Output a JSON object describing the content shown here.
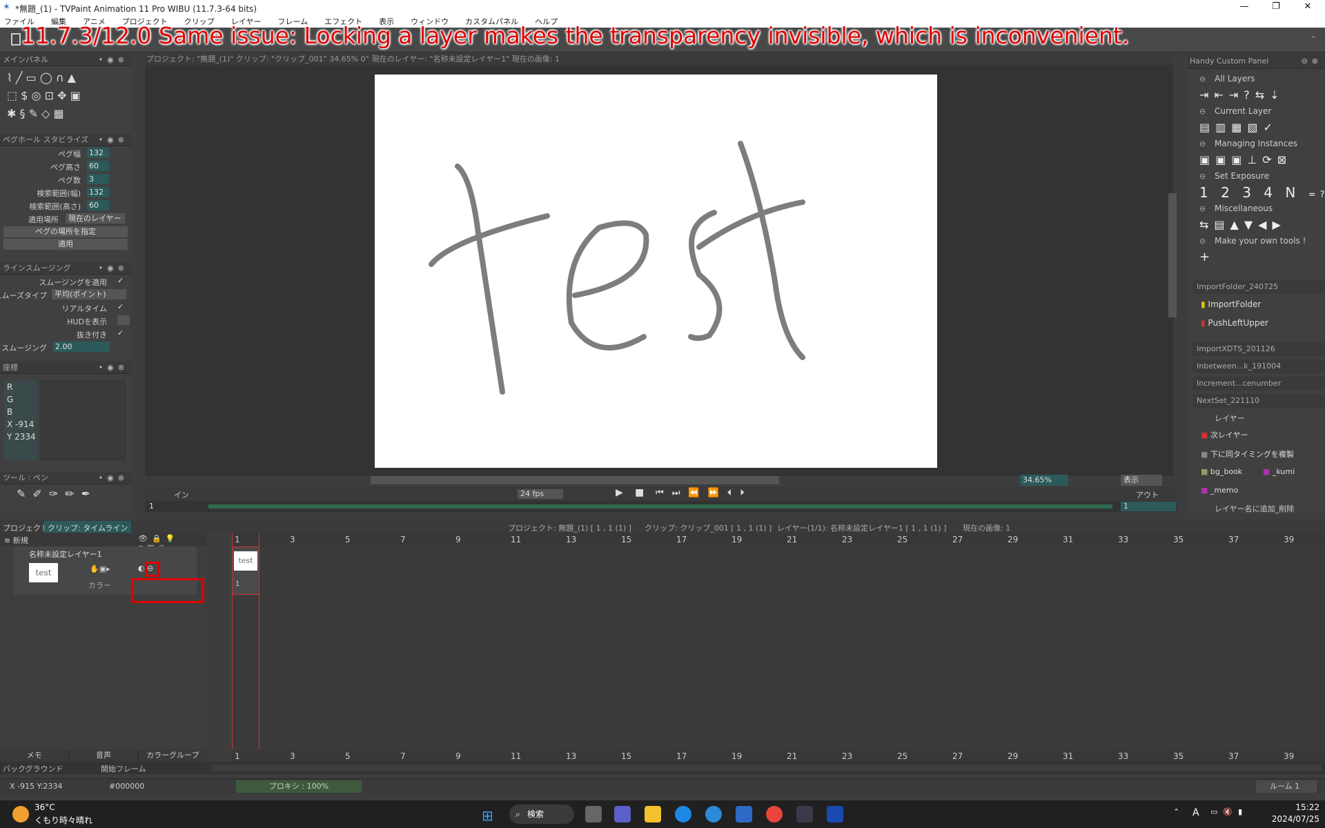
{
  "window": {
    "title": "*無題_(1) - TVPaint Animation 11 Pro WIBU (11.7.3-64 bits)",
    "min": "—",
    "max": "❐",
    "close": "✕"
  },
  "menu": [
    "ファイル",
    "編集",
    "アニメ",
    "プロジェクト",
    "クリップ",
    "レイヤー",
    "フレーム",
    "エフェクト",
    "表示",
    "ウィンドウ",
    "カスタムパネル",
    "ヘルプ"
  ],
  "overlay_text": "11.7.3/12.0 Same issue: Locking a layer makes the transparency invisible, which is inconvenient.",
  "main_panel": {
    "title": "メインパネル"
  },
  "peg": {
    "title": "ペグホール スタビライズ",
    "rows": [
      {
        "label": "ペグ幅",
        "value": "132"
      },
      {
        "label": "ペグ高さ",
        "value": "60"
      },
      {
        "label": "ペグ数",
        "value": "3"
      },
      {
        "label": "検索範囲(幅)",
        "value": "132"
      },
      {
        "label": "検索範囲(高さ)",
        "value": "60"
      }
    ],
    "apply_place_label": "適用場所",
    "apply_place_value": "現在のレイヤー",
    "set_peg_button": "ペグの場所を指定",
    "apply_button": "適用"
  },
  "line_smoothing": {
    "title": "ラインスムージング",
    "apply_label": "スムージングを適用",
    "type_label": "スムーズタイプ",
    "type_value": "平均(ポイント)",
    "realtime_label": "リアルタイム",
    "hud_label": "HUDを表示",
    "taper_label": "抜き付き",
    "smoothing_label": "スムージング",
    "smoothing_value": "2.00",
    "check": "✓"
  },
  "coords": {
    "title": "座標",
    "r": "R",
    "g": "G",
    "b": "B",
    "x": "X -914",
    "y": "Y 2334"
  },
  "tools_panel": {
    "title": "ツール : ペン"
  },
  "canvas_header": "プロジェクト: \"無題_(1)\"  クリップ: \"クリップ_001\"  34.65%  0°  現在のレイヤー: \"名称未設定レイヤー1\"  現在の画像: 1",
  "canvas_text": "test",
  "playback": {
    "fps": "24 fps",
    "in_label": "イン",
    "out_label": "アウト",
    "in_value": "1",
    "out_value": "1",
    "zoom": "34.65%",
    "view": "表示"
  },
  "right_panel": {
    "title": "Handy Custom Panel",
    "sections": [
      "All Layers",
      "Current Layer",
      "Managing Instances",
      "Set Exposure",
      "Miscellaneous",
      "Make your own tools !"
    ],
    "exposure_numbers": [
      "1",
      "2",
      "3",
      "4",
      "N",
      "=?"
    ],
    "plus": "+",
    "import_folder_title": "ImportFolder_240725",
    "import_items": [
      "ImportFolder",
      "PushLeftUpper"
    ],
    "collapsed": [
      "ImportXDTS_201126",
      "Inbetween...k_191004",
      "Increment...cenumber",
      "NextSet_221110"
    ],
    "nextset_section": "レイヤー",
    "nextset_items": [
      "次レイヤー",
      "下に同タイミングを複製",
      "bg_book",
      "_kumi",
      "_memo",
      "レイヤー名に追加_削除"
    ]
  },
  "timeline": {
    "tabs": [
      "プロジェクト",
      "クリップ: タイムライン"
    ],
    "info": [
      "プロジェクト: 無題_(1) [ 1 , 1 (1) ]",
      "クリップ: クリップ_001 [ 1 , 1 (1) ]",
      "レイヤー(1/1): 名称未設定レイヤー1 [ 1 , 1 (1) ]",
      "現在の画像: 1"
    ],
    "new_label": "新規",
    "layer_name": "名称未設定レイヤー1",
    "color_label": "カラー",
    "thumb_text": "test",
    "frame_numbers": [
      "1",
      "3",
      "5",
      "7",
      "9",
      "11",
      "13",
      "15",
      "17",
      "19",
      "21",
      "23",
      "25",
      "27",
      "29",
      "31",
      "33",
      "35",
      "37",
      "39"
    ],
    "frame_sub": "1",
    "bottom_tabs": [
      "メモ",
      "音声",
      "カラーグループ"
    ],
    "bg_label": "バックグラウンド",
    "start_frame_label": "開始フレーム"
  },
  "statusbar": {
    "coords": "X -915  Y:2334",
    "color": "#000000",
    "proxy": "プロキシ : 100%",
    "room": "ルーム 1"
  },
  "taskbar": {
    "weather_temp": "36°C",
    "weather_desc": "くもり時々晴れ",
    "search": "検索",
    "time": "15:22",
    "date": "2024/07/25",
    "ime": "A"
  }
}
